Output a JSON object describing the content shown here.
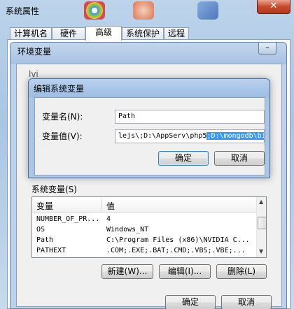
{
  "outer": {
    "title": "系统属性",
    "close": "✕",
    "tabs": [
      "计算机名",
      "硬件",
      "高级",
      "系统保护",
      "远程"
    ],
    "ok": "确定",
    "cancel": "取消"
  },
  "env": {
    "title": "环境变量",
    "min": "–",
    "user_vars_header": "lvi",
    "system_label": "系统变量(S)",
    "columns": [
      "变量",
      "值"
    ],
    "rows": [
      {
        "name": "NUMBER_OF_PR...",
        "value": "4"
      },
      {
        "name": "OS",
        "value": "Windows_NT"
      },
      {
        "name": "Path",
        "value": "C:\\Program Files (x86)\\NVIDIA C..."
      },
      {
        "name": "PATHEXT",
        "value": ".COM;.EXE;.BAT;.CMD;.VBS;.VBE;..."
      }
    ],
    "new": "新建(W)...",
    "edit": "编辑(I)...",
    "delete": "删除(L)"
  },
  "edit": {
    "title": "编辑系统变量",
    "name_label": "变量名(N):",
    "value_label": "变量值(V):",
    "name_value": "Path",
    "value_plain": "lejs\\;D:\\AppServ\\php5",
    "value_selected": ";D:\\mongodb\\bin",
    "ok": "确定",
    "cancel": "取消"
  }
}
